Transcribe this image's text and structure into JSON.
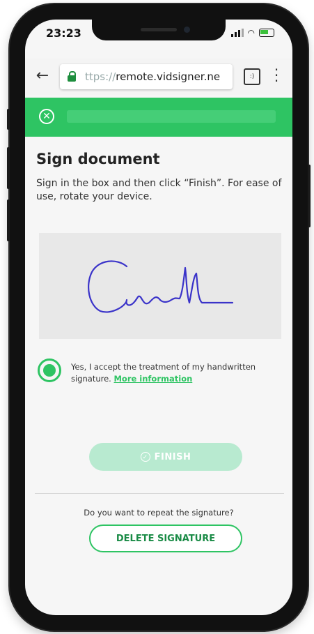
{
  "status_bar": {
    "time": "23:23"
  },
  "browser": {
    "url_prefix": "ttps://",
    "url_main": "remote.vidsigner.ne",
    "tab_count": ":)"
  },
  "page": {
    "title": "Sign document",
    "instructions": "Sign in the box and then click “Finish”. For ease of use, rotate your device."
  },
  "consent": {
    "text": "Yes, I accept the treatment of my handwritten signature. ",
    "link": "More information",
    "checked": true
  },
  "finish_label": "FINISH",
  "repeat_question": "Do you want to repeat the signature?",
  "delete_label": "DELETE SIGNATURE",
  "colors": {
    "accent": "#2ec463",
    "signature_ink": "#3a33c9"
  },
  "icons": [
    "back-arrow-icon",
    "lock-icon",
    "tabs-icon",
    "menu-dots-icon",
    "close-icon",
    "check-icon"
  ]
}
